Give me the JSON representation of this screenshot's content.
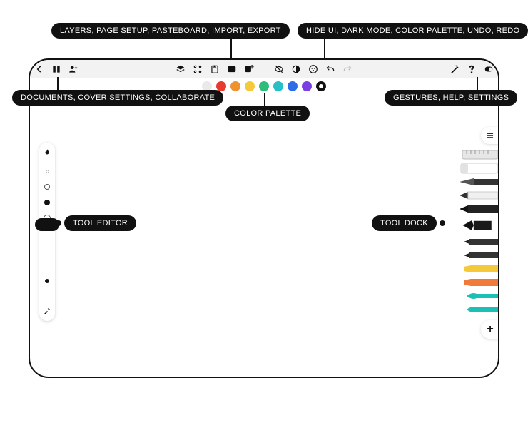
{
  "callouts": {
    "top_left": "LAYERS, PAGE SETUP, PASTEBOARD, IMPORT, EXPORT",
    "top_right": "HIDE UI, DARK MODE, COLOR PALETTE, UNDO, REDO",
    "left_group": "DOCUMENTS, COVER SETTINGS, COLLABORATE",
    "right_group": "GESTURES, HELP, SETTINGS",
    "color_palette": "COLOR PALETTE",
    "tool_editor": "TOOL EDITOR",
    "tool_dock": "TOOL DOCK"
  },
  "toolbar": {
    "left": [
      {
        "name": "back-icon",
        "glyph": "arrow-left"
      },
      {
        "name": "documents-icon",
        "glyph": "book"
      },
      {
        "name": "collaborate-icon",
        "glyph": "person-plus"
      }
    ],
    "center": [
      {
        "name": "layers-icon",
        "glyph": "stack"
      },
      {
        "name": "page-setup-icon",
        "glyph": "grid"
      },
      {
        "name": "pasteboard-icon",
        "glyph": "clipboard"
      },
      {
        "name": "import-icon",
        "glyph": "image-in"
      },
      {
        "name": "export-icon",
        "glyph": "image-out"
      }
    ],
    "center2": [
      {
        "name": "hide-ui-icon",
        "glyph": "eye-off"
      },
      {
        "name": "dark-mode-icon",
        "glyph": "half-circle"
      },
      {
        "name": "palette-icon",
        "glyph": "dots-circle"
      },
      {
        "name": "undo-icon",
        "glyph": "undo"
      },
      {
        "name": "redo-icon",
        "glyph": "redo",
        "dim": true
      }
    ],
    "right": [
      {
        "name": "gestures-icon",
        "glyph": "pencil-hand"
      },
      {
        "name": "help-icon",
        "glyph": "help"
      },
      {
        "name": "settings-icon",
        "glyph": "toggle"
      }
    ]
  },
  "palette": [
    "#e9e9e9",
    "#e83a2e",
    "#f0912c",
    "#f4c93a",
    "#2fbd7b",
    "#26c0c7",
    "#2e6be6",
    "#7b3fe4",
    "ring"
  ],
  "tool_editor": {
    "top_icon": "flame-icon",
    "circles": [
      "open",
      "open",
      "fill",
      "open"
    ],
    "slider_dot": "slider-dot",
    "eyedropper": "eyedropper-icon"
  },
  "tool_dock": {
    "tab_icon": "menu-icon",
    "tools": [
      {
        "name": "ruler-tool",
        "color": "#e0e0e0",
        "shape": "ruler"
      },
      {
        "name": "eraser-tool",
        "color": "#ffffff",
        "shape": "block"
      },
      {
        "name": "knife-tool",
        "color": "#444",
        "shape": "knife"
      },
      {
        "name": "pencil-light-tool",
        "color": "#f2f2f2",
        "shape": "pencil"
      },
      {
        "name": "pencil-dark-tool",
        "color": "#222",
        "shape": "pencil"
      },
      {
        "name": "nib-pen-tool",
        "color": "#111",
        "shape": "nib"
      },
      {
        "name": "fineliner-tool",
        "color": "#333",
        "shape": "fineliner"
      },
      {
        "name": "fineliner2-tool",
        "color": "#333",
        "shape": "fineliner"
      },
      {
        "name": "highlighter-yellow-tool",
        "color": "#f4c93a",
        "shape": "chisel"
      },
      {
        "name": "marker-orange-tool",
        "color": "#f07a3a",
        "shape": "chisel"
      },
      {
        "name": "brush-teal-tool",
        "color": "#1cbfb6",
        "shape": "brush"
      },
      {
        "name": "brush-teal2-tool",
        "color": "#1cbfb6",
        "shape": "brush"
      }
    ],
    "add_label": "+"
  }
}
